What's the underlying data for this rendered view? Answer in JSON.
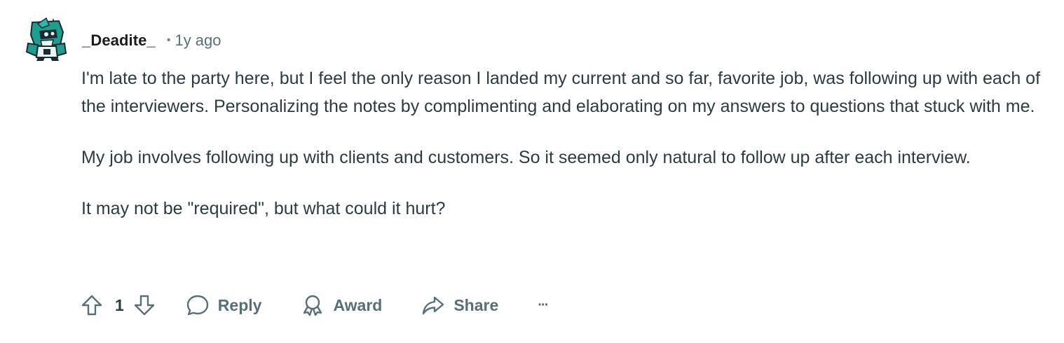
{
  "comment": {
    "author": "_Deadite_",
    "separator": "•",
    "time_ago": "1y ago",
    "paragraphs": [
      "I'm late to the party here, but I feel the only reason I landed my current and so far, favorite job, was following up with each of the interviewers. Personalizing the notes by complimenting and elaborating on my answers to questions that stuck with me.",
      "My job involves following up with clients and customers. So it seemed only natural to follow up after each interview.",
      "It may not be \"required\", but what could it hurt?"
    ],
    "actions": {
      "vote_count": "1",
      "reply_label": "Reply",
      "award_label": "Award",
      "share_label": "Share",
      "more_label": "···"
    },
    "avatar": {
      "icon": "robot-avatar-icon",
      "colors": {
        "body": "#1f9e8f",
        "dark": "#1b2a33",
        "light": "#e8f3f2"
      }
    }
  }
}
